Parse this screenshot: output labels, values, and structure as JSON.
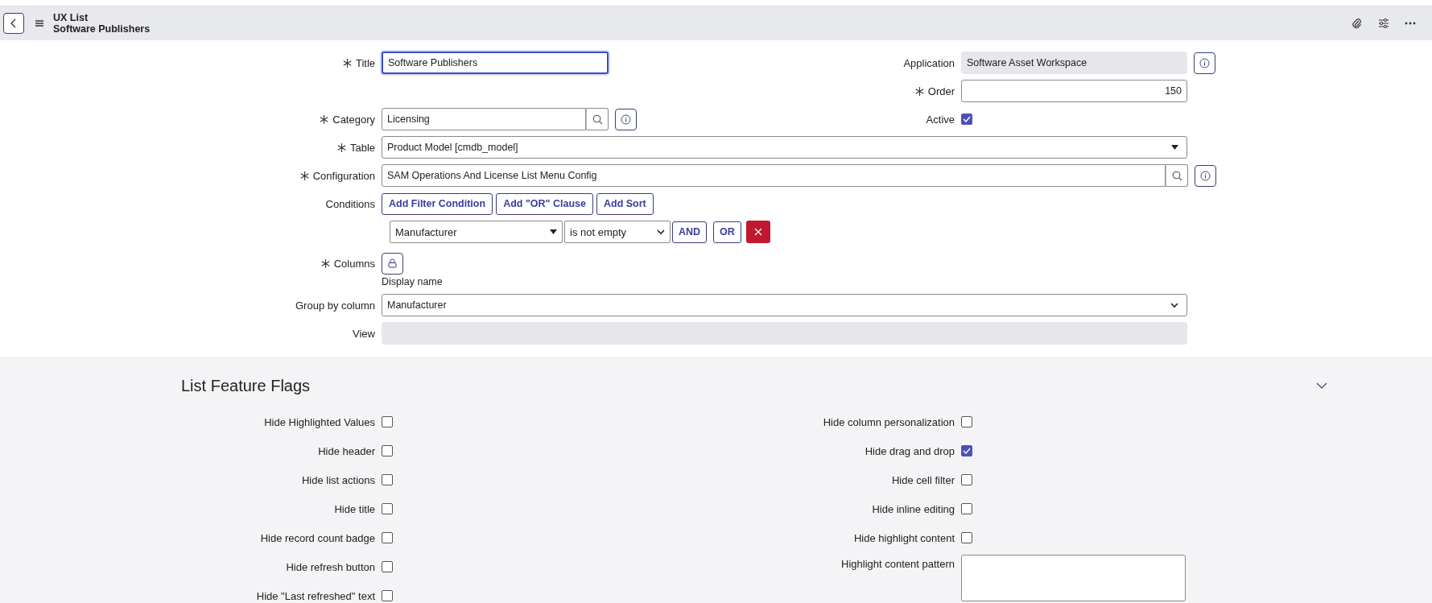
{
  "header": {
    "title": "UX List",
    "subtitle": "Software Publishers"
  },
  "form": {
    "title": {
      "label": "Title",
      "required": true,
      "value": "Software Publishers"
    },
    "application": {
      "label": "Application",
      "value": "Software Asset Workspace"
    },
    "order": {
      "label": "Order",
      "required": true,
      "value": "150"
    },
    "category": {
      "label": "Category",
      "required": true,
      "value": "Licensing"
    },
    "active": {
      "label": "Active",
      "checked": true
    },
    "table": {
      "label": "Table",
      "required": true,
      "value": "Product Model [cmdb_model]"
    },
    "configuration": {
      "label": "Configuration",
      "required": true,
      "value": "SAM Operations And License List Menu Config"
    },
    "conditions": {
      "label": "Conditions",
      "buttons": [
        "Add Filter Condition",
        "Add \"OR\" Clause",
        "Add Sort"
      ],
      "filter": {
        "field": "Manufacturer",
        "operator": "is not empty",
        "and": "AND",
        "or": "OR"
      }
    },
    "columns": {
      "label": "Columns",
      "required": true,
      "hint": "Display name"
    },
    "group_by": {
      "label": "Group by column",
      "value": "Manufacturer"
    },
    "view": {
      "label": "View"
    }
  },
  "section": {
    "title": "List Feature Flags",
    "expanded": true,
    "left_flags": [
      {
        "label": "Hide Highlighted Values",
        "checked": false
      },
      {
        "label": "Hide header",
        "checked": false
      },
      {
        "label": "Hide list actions",
        "checked": false
      },
      {
        "label": "Hide title",
        "checked": false
      },
      {
        "label": "Hide record count badge",
        "checked": false
      },
      {
        "label": "Hide refresh button",
        "checked": false
      },
      {
        "label": "Hide \"Last refreshed\" text",
        "checked": false
      }
    ],
    "right_flags": [
      {
        "kind": "checkbox",
        "label": "Hide column personalization",
        "checked": false
      },
      {
        "kind": "checkbox",
        "label": "Hide drag and drop",
        "checked": true
      },
      {
        "kind": "checkbox",
        "label": "Hide cell filter",
        "checked": false
      },
      {
        "kind": "checkbox",
        "label": "Hide inline editing",
        "checked": false
      },
      {
        "kind": "checkbox",
        "label": "Hide highlight content",
        "checked": false
      },
      {
        "kind": "textarea",
        "label": "Highlight content pattern"
      }
    ]
  }
}
